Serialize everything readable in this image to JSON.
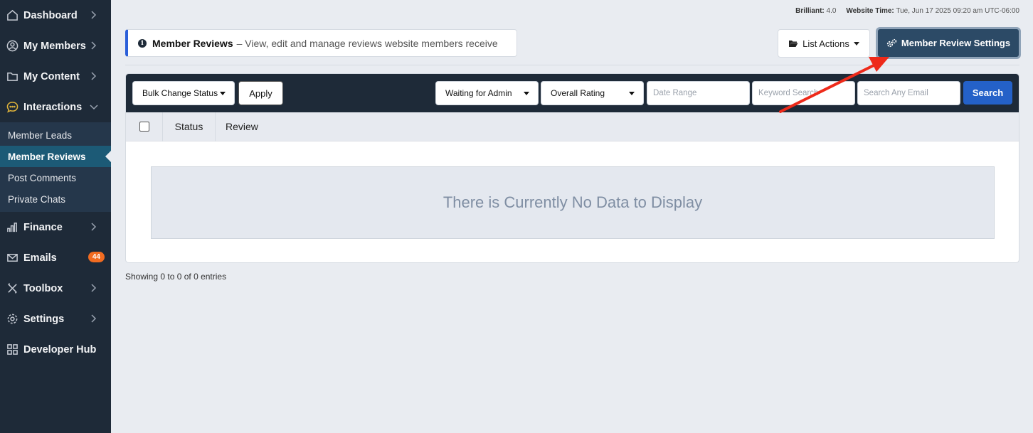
{
  "sidebar": {
    "items": [
      {
        "label": "Dashboard",
        "icon": "home-icon"
      },
      {
        "label": "My Members",
        "icon": "user-icon"
      },
      {
        "label": "My Content",
        "icon": "folder-icon"
      },
      {
        "label": "Interactions",
        "icon": "chat-icon"
      },
      {
        "label": "Finance",
        "icon": "bar-chart-icon"
      },
      {
        "label": "Emails",
        "icon": "envelope-icon",
        "badge": "44"
      },
      {
        "label": "Toolbox",
        "icon": "tools-icon"
      },
      {
        "label": "Settings",
        "icon": "gear-icon"
      },
      {
        "label": "Developer Hub",
        "icon": "grid-icon"
      }
    ],
    "sub_items": [
      {
        "label": "Member Leads"
      },
      {
        "label": "Member Reviews",
        "active": true
      },
      {
        "label": "Post Comments"
      },
      {
        "label": "Private Chats"
      }
    ]
  },
  "meta": {
    "version_label": "Brilliant:",
    "version_value": "4.0",
    "time_label": "Website Time:",
    "time_value": "Tue, Jun 17 2025 09:20 am UTC-06:00"
  },
  "header": {
    "title": "Member Reviews",
    "description": "– View, edit and manage reviews website members receive",
    "list_actions_label": "List Actions",
    "settings_label": "Member Review Settings"
  },
  "toolbar": {
    "bulk_label": "Bulk Change Status",
    "apply_label": "Apply",
    "status_filter": "Waiting for Admin",
    "rating_filter": "Overall Rating",
    "date_placeholder": "Date Range",
    "keyword_placeholder": "Keyword Search",
    "email_placeholder": "Search Any Email",
    "search_label": "Search"
  },
  "table": {
    "columns": [
      "Status",
      "Review"
    ],
    "empty_message": "There is Currently No Data to Display"
  },
  "footer": {
    "showing": "Showing 0 to 0 of 0 entries"
  },
  "colors": {
    "sidebar_bg": "#1e2a38",
    "accent_blue": "#2461c8",
    "badge_orange": "#f26c21",
    "annotation_arrow": "#ee2a1a"
  }
}
